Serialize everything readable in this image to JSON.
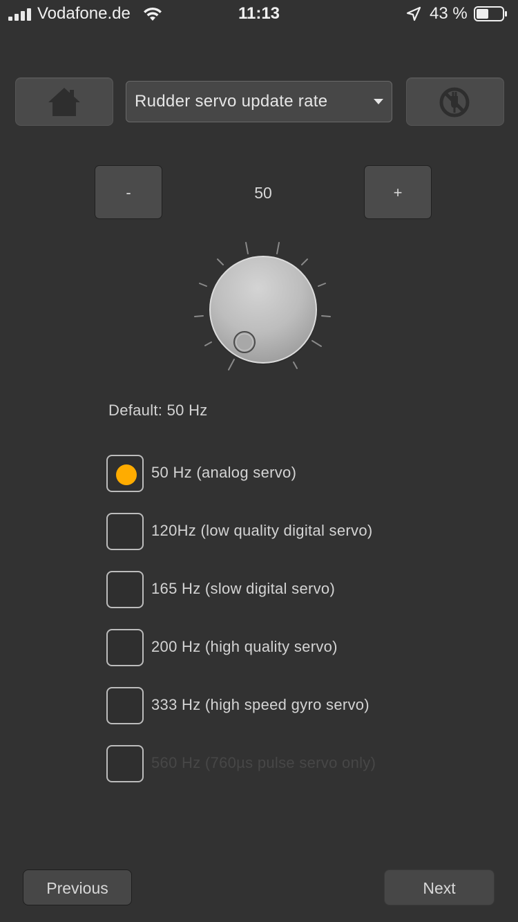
{
  "status_bar": {
    "carrier": "Vodafone.de",
    "time": "11:13",
    "battery_percent": "43 %"
  },
  "header": {
    "selected_setting": "Rudder servo update rate"
  },
  "stepper": {
    "minus_label": "-",
    "plus_label": "+",
    "value": "50"
  },
  "knob": {
    "icon": "rotary-knob"
  },
  "default_text": "Default: 50 Hz",
  "options": [
    {
      "label": "50 Hz (analog servo)",
      "selected": true,
      "enabled": true
    },
    {
      "label": "120Hz (low quality digital servo)",
      "selected": false,
      "enabled": true
    },
    {
      "label": "165 Hz (slow digital servo)",
      "selected": false,
      "enabled": true
    },
    {
      "label": "200 Hz (high quality servo)",
      "selected": false,
      "enabled": true
    },
    {
      "label": "333 Hz (high speed gyro servo)",
      "selected": false,
      "enabled": true
    },
    {
      "label": "560 Hz (760µs pulse servo only)",
      "selected": false,
      "enabled": false
    }
  ],
  "navigation": {
    "previous_label": "Previous",
    "next_label": "Next"
  },
  "colors": {
    "background": "#323232",
    "accent": "#ffac00"
  }
}
